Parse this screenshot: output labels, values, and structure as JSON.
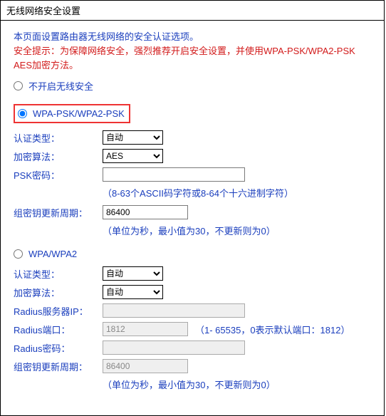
{
  "title": "无线网络安全设置",
  "intro": "本页面设置路由器无线网络的安全认证选项。",
  "warning": "安全提示：为保障网络安全，强烈推荐开启安全设置，并使用WPA-PSK/WPA2-PSK AES加密方法。",
  "sec0": {
    "radio_label": "不开启无线安全"
  },
  "sec1": {
    "radio_label": "WPA-PSK/WPA2-PSK",
    "auth_label": "认证类型：",
    "auth_value": "自动",
    "enc_label": "加密算法：",
    "enc_value": "AES",
    "psk_label": "PSK密码：",
    "psk_value": "",
    "psk_hint": "（8-63个ASCII码字符或8-64个十六进制字符）",
    "group_label": "组密钥更新周期：",
    "group_value": "86400",
    "group_hint": "（单位为秒，最小值为30，不更新则为0）"
  },
  "sec2": {
    "radio_label": "WPA/WPA2",
    "auth_label": "认证类型：",
    "auth_value": "自动",
    "enc_label": "加密算法：",
    "enc_value": "自动",
    "radius_ip_label": "Radius服务器IP：",
    "radius_ip_value": "",
    "radius_port_label": "Radius端口：",
    "radius_port_value": "1812",
    "radius_port_hint": "（1- 65535，0表示默认端口：1812）",
    "radius_pwd_label": "Radius密码：",
    "radius_pwd_value": "",
    "group_label": "组密钥更新周期：",
    "group_value": "86400",
    "group_hint": "（单位为秒，最小值为30，不更新则为0）"
  }
}
